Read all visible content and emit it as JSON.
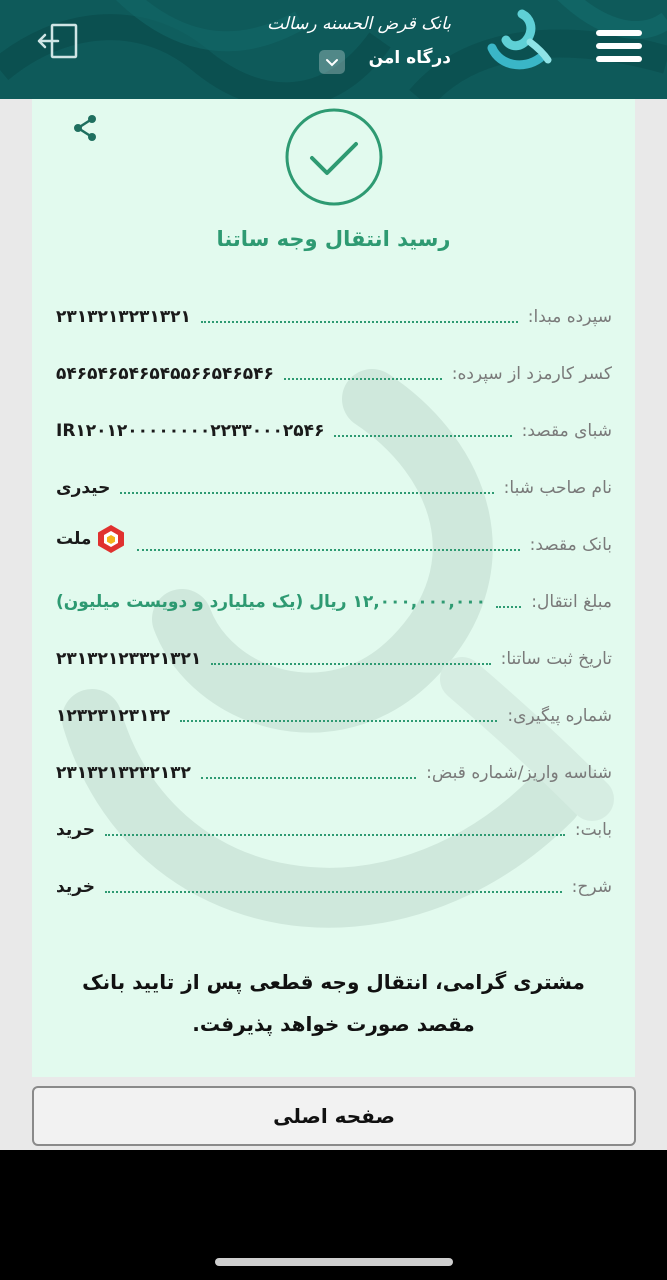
{
  "header": {
    "bank_name": "بانک قرض الحسنه رسالت",
    "gateway_label": "درگاه امن",
    "menu_icon": "hamburger-menu-icon",
    "exit_icon": "logout-icon",
    "dropdown_icon": "chevron-down-icon",
    "logo_icon": "resalat-logo-icon"
  },
  "receipt": {
    "title": "رسید انتقال وجه ساتنا",
    "share_icon": "share-icon",
    "success_icon": "check-circle-icon",
    "rows": [
      {
        "label": "سپرده مبدا:",
        "value": "۲۳۱۳۲۱۳۲۳۱۳۲۱"
      },
      {
        "label": "کسر کارمزد از سپرده:",
        "value": "۵۴۶۵۴۶۵۴۶۵۴۵۵۶۶۵۴۶۵۴۶"
      },
      {
        "label": "شبای مقصد:",
        "value": "IR۱۲۰۱۲۰۰۰۰۰۰۰۰۲۲۳۳۰۰۰۲۵۴۶"
      },
      {
        "label": "نام صاحب شبا:",
        "value": "حیدری"
      },
      {
        "label": "بانک مقصد:",
        "value": "ملت"
      },
      {
        "label": "مبلغ انتقال:",
        "value": "۱۲,۰۰۰,۰۰۰,۰۰۰ ریال (یک میلیارد و دویست میلیون)"
      },
      {
        "label": "تاریخ ثبت ساتنا:",
        "value": "۲۳۱۳۲۱۲۳۳۲۱۳۲۱"
      },
      {
        "label": "شماره پیگیری:",
        "value": "۱۲۳۲۳۱۲۳۱۳۲"
      },
      {
        "label": "شناسه واریز/شماره قبض:",
        "value": "۲۳۱۳۲۱۳۲۳۲۱۳۲"
      },
      {
        "label": "بابت:",
        "value": "حرید"
      },
      {
        "label": "شرح:",
        "value": "خرید"
      }
    ],
    "notice": "مشتری گرامی، انتقال وجه قطعی پس از تایید بانک مقصد صورت خواهد پذیرفت."
  },
  "footer": {
    "home_button": "صفحه اصلی"
  },
  "colors": {
    "header_bg": "#0e5a5a",
    "card_bg": "#e2faee",
    "accent_green": "#2e9a72",
    "mellat_red": "#e0312f"
  }
}
